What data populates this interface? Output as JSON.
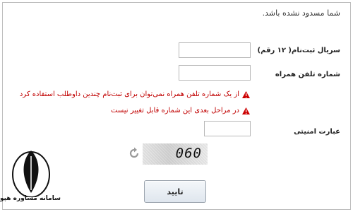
{
  "page": {
    "top_message": "شما مسدود نشده باشد."
  },
  "form": {
    "serial_label": "سریال ثبت‌نام( ۱۲ رقم)",
    "serial_value": "",
    "phone_label": "شماره تلفن همراه",
    "phone_value": "",
    "security_label": "عبارت امنیتی",
    "security_value": ""
  },
  "warnings": [
    "از یک شماره تلفن همراه نمی‌توان برای ثبت‌نام چندین داوطلب استفاده کرد",
    "در مراحل بعدی این شماره قابل تغییر نیست"
  ],
  "captcha": {
    "text": "060",
    "refresh_icon": "refresh-icon"
  },
  "submit_label": "تایید",
  "logo": {
    "caption": "سامانه مشاوره هپوا"
  },
  "colors": {
    "warning_text": "#c00000",
    "warning_icon": "#cc0000",
    "border": "#bdbdbd"
  }
}
